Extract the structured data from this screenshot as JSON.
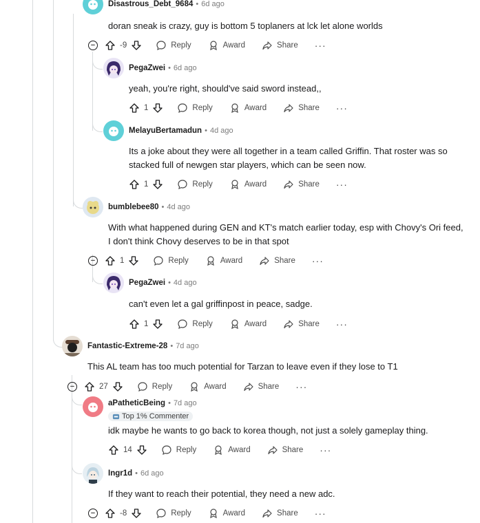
{
  "labels": {
    "reply": "Reply",
    "award": "Award",
    "share": "Share",
    "more": "···",
    "collapse": "−",
    "dot": "•"
  },
  "comments": [
    {
      "username": "Disastrous_Debt_9684",
      "age": "6d ago",
      "text": "doran sneak is crazy, guy is bottom 5 toplaners at lck let alone worlds",
      "score": "-9",
      "avatar_color": "#5fd0d8"
    },
    {
      "username": "PegaZwei",
      "age": "6d ago",
      "text": "yeah, you're right, should've said sword instead,,",
      "score": "1",
      "avatar_color": "#6b3fb5"
    },
    {
      "username": "MelayuBertamadun",
      "age": "4d ago",
      "text": "Its a joke about they were all together in a team called Griffin. That roster was so stacked full of newgen star players, which can be seen now.",
      "score": "1",
      "avatar_color": "#5fd0d8"
    },
    {
      "username": "bumblebee80",
      "age": "4d ago",
      "text": "With what happened during GEN and KT's match earlier today, esp with Chovy's Ori feed, I don't think Chovy deserves to be in that spot",
      "score": "1",
      "avatar_color": "#e8d98a"
    },
    {
      "username": "PegaZwei",
      "age": "4d ago",
      "text": "can't even let a gal griffinpost in peace, sadge.",
      "score": "1",
      "avatar_color": "#6b3fb5"
    },
    {
      "username": "Fantastic-Extreme-28",
      "age": "7d ago",
      "text": "This AL team has too much potential for Tarzan to leave even if they lose to T1",
      "score": "27",
      "avatar_color": "#7a6a5a"
    },
    {
      "username": "aPatheticBeing",
      "age": "7d ago",
      "flair": "Top 1% Commenter",
      "text": "idk maybe he wants to go back to korea though, not just a solely gameplay thing.",
      "score": "14",
      "avatar_color": "#f07b85"
    },
    {
      "username": "Ingr1d",
      "age": "6d ago",
      "text": "If they want to reach their potential, they need a new adc.",
      "score": "-8",
      "avatar_color": "#bcd3e0"
    }
  ]
}
